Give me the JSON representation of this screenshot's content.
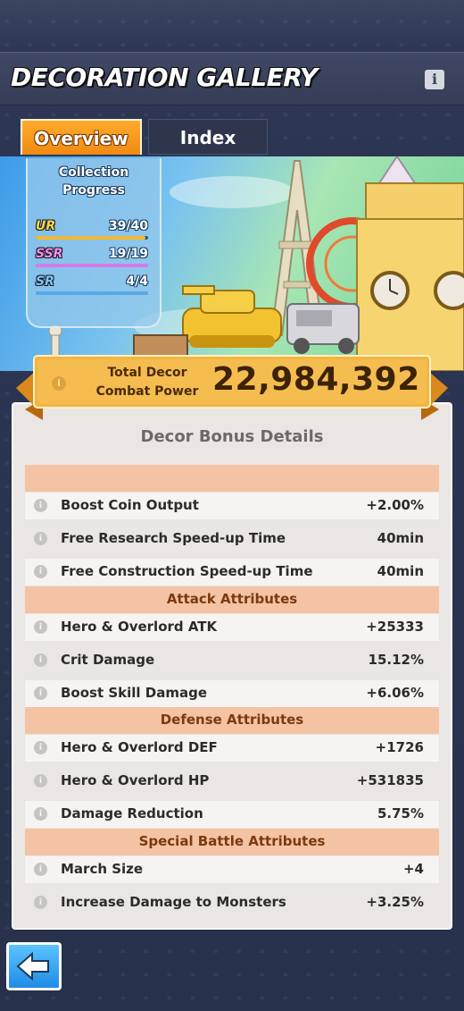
{
  "header": {
    "title": "DECORATION GALLERY",
    "info_icon": "info-icon"
  },
  "tabs": [
    {
      "label": "Overview",
      "active": true
    },
    {
      "label": "Index",
      "active": false
    }
  ],
  "collection": {
    "title": "Collection Progress",
    "rarities": [
      {
        "name": "UR",
        "count": "39/40",
        "color": "#ffd84a",
        "bar_color": "#f3b832",
        "fill": 0.975
      },
      {
        "name": "SSR",
        "count": "19/19",
        "color": "#f58cf0",
        "bar_color": "#d77ae6",
        "fill": 1.0
      },
      {
        "name": "SR",
        "count": "4/4",
        "color": "#7ec6ff",
        "bar_color": "#5aa8ea",
        "fill": 1.0
      }
    ]
  },
  "combat_power": {
    "label": "Total Decor Combat Power",
    "value": "22,984,392"
  },
  "details": {
    "title": "Decor Bonus Details",
    "rows": [
      {
        "type": "section",
        "label": ""
      },
      {
        "type": "stat",
        "label": "Boost Coin Output",
        "value": "+2.00%"
      },
      {
        "type": "stat",
        "label": "Free Research Speed-up Time",
        "value": "40min"
      },
      {
        "type": "stat",
        "label": "Free Construction Speed-up Time",
        "value": "40min"
      },
      {
        "type": "section",
        "label": "Attack Attributes"
      },
      {
        "type": "stat",
        "label": "Hero & Overlord ATK",
        "value": "+25333"
      },
      {
        "type": "stat",
        "label": "Crit Damage",
        "value": "15.12%"
      },
      {
        "type": "stat",
        "label": "Boost Skill Damage",
        "value": "+6.06%"
      },
      {
        "type": "section",
        "label": "Defense Attributes"
      },
      {
        "type": "stat",
        "label": "Hero & Overlord DEF",
        "value": "+1726"
      },
      {
        "type": "stat",
        "label": "Hero & Overlord HP",
        "value": "+531835"
      },
      {
        "type": "stat",
        "label": "Damage Reduction",
        "value": "5.75%"
      },
      {
        "type": "section",
        "label": "Special Battle Attributes"
      },
      {
        "type": "stat",
        "label": "March Size",
        "value": "+4"
      },
      {
        "type": "stat",
        "label": "Increase Damage to Monsters",
        "value": "+3.25%"
      }
    ]
  },
  "back_button": {
    "icon": "back-arrow-icon"
  }
}
